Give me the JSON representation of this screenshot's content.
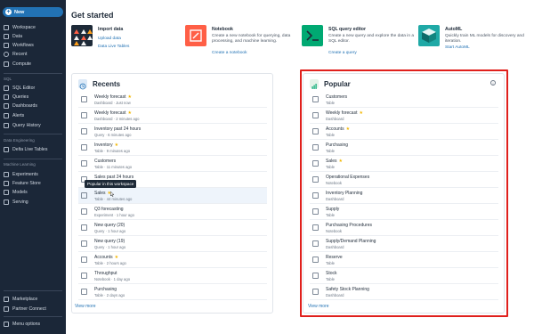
{
  "sidebar": {
    "new_label": "New",
    "top_items": [
      {
        "label": "Workspace",
        "icon": "workspace-icon"
      },
      {
        "label": "Data",
        "icon": "data-icon"
      },
      {
        "label": "Workflows",
        "icon": "workflows-icon"
      },
      {
        "label": "Recent",
        "icon": "clock-icon"
      },
      {
        "label": "Compute",
        "icon": "compute-icon"
      }
    ],
    "sql_section": "SQL",
    "sql_items": [
      {
        "label": "SQL Editor",
        "icon": "sql-editor-icon"
      },
      {
        "label": "Queries",
        "icon": "queries-icon"
      },
      {
        "label": "Dashboards",
        "icon": "dashboards-icon"
      },
      {
        "label": "Alerts",
        "icon": "bell-icon"
      },
      {
        "label": "Query History",
        "icon": "history-icon"
      }
    ],
    "de_section": "Data Engineering",
    "de_items": [
      {
        "label": "Delta Live Tables",
        "icon": "dlt-icon"
      }
    ],
    "ml_section": "Machine Learning",
    "ml_items": [
      {
        "label": "Experiments",
        "icon": "experiments-icon"
      },
      {
        "label": "Feature Store",
        "icon": "feature-store-icon"
      },
      {
        "label": "Models",
        "icon": "models-icon"
      },
      {
        "label": "Serving",
        "icon": "serving-icon"
      }
    ],
    "bottom_items": [
      {
        "label": "Marketplace",
        "icon": "marketplace-icon"
      },
      {
        "label": "Partner Connect",
        "icon": "partner-icon"
      }
    ],
    "menu_options": "Menu options"
  },
  "main": {
    "title": "Get started",
    "cards": [
      {
        "title": "Import data",
        "desc": "",
        "links": [
          "Upload data",
          "Data Live Tables"
        ]
      },
      {
        "title": "Notebook",
        "desc": "Create a new notebook for querying, data processing, and machine learning.",
        "links": [
          "Create a notebook"
        ]
      },
      {
        "title": "SQL query editor",
        "desc": "Create a new query and explore the data in a SQL editor.",
        "links": [
          "Create a query"
        ]
      },
      {
        "title": "AutoML",
        "desc": "Quickly train ML models for discovery and iteration.",
        "links": [
          "Start AutoML"
        ]
      }
    ]
  },
  "recents": {
    "title": "Recents",
    "view_more": "View more",
    "tooltip": "Popular in this workspace",
    "items": [
      {
        "name": "Weekly forecast",
        "sub": "Dashboard · Just now",
        "starred": true
      },
      {
        "name": "Weekly forecast",
        "sub": "Dashboard · 2 minutes ago",
        "starred": true
      },
      {
        "name": "Inventory past 24 hours",
        "sub": "Query · 6 minutes ago",
        "starred": false
      },
      {
        "name": "Inventory",
        "sub": "Table · 9 minutes ago",
        "starred": true
      },
      {
        "name": "Customers",
        "sub": "Table · 11 minutes ago",
        "starred": false
      },
      {
        "name": "Sales past 24 hours",
        "sub": "Query · 42 minutes ago",
        "starred": false
      },
      {
        "name": "Sales",
        "sub": "Table · 44 minutes ago",
        "starred": true
      },
      {
        "name": "Q3 forecasting",
        "sub": "Experiment · 1 hour ago",
        "starred": false
      },
      {
        "name": "New query (20)",
        "sub": "Query · 1 hour ago",
        "starred": false
      },
      {
        "name": "New query (19)",
        "sub": "Query · 1 hour ago",
        "starred": false
      },
      {
        "name": "Accounts",
        "sub": "Table · 2 hours ago",
        "starred": true
      },
      {
        "name": "Throughput",
        "sub": "Notebook · 1 day ago",
        "starred": false
      },
      {
        "name": "Purchasing",
        "sub": "Table · 2 days ago",
        "starred": false
      }
    ]
  },
  "popular": {
    "title": "Popular",
    "view_more": "View more",
    "items": [
      {
        "name": "Customers",
        "sub": "Table",
        "starred": false
      },
      {
        "name": "Weekly forecast",
        "sub": "Dashboard",
        "starred": true
      },
      {
        "name": "Accounts",
        "sub": "Table",
        "starred": true
      },
      {
        "name": "Purchasing",
        "sub": "Table",
        "starred": false
      },
      {
        "name": "Sales",
        "sub": "Table",
        "starred": true
      },
      {
        "name": "Operational Expenses",
        "sub": "Notebook",
        "starred": false
      },
      {
        "name": "Inventory Planning",
        "sub": "Dashboard",
        "starred": false
      },
      {
        "name": "Supply",
        "sub": "Table",
        "starred": false
      },
      {
        "name": "Purchasing Procedures",
        "sub": "Notebook",
        "starred": false
      },
      {
        "name": "Supply/Demand Planning",
        "sub": "Dashboard",
        "starred": false
      },
      {
        "name": "Reserve",
        "sub": "Table",
        "starred": false
      },
      {
        "name": "Stock",
        "sub": "Table",
        "starred": false
      },
      {
        "name": "Safety Stock Planning",
        "sub": "Dashboard",
        "starred": false
      }
    ]
  },
  "colors": {
    "sidebar_bg": "#1b2738",
    "accent": "#2272b4",
    "star": "#f2b600",
    "highlight": "#e0201c"
  }
}
